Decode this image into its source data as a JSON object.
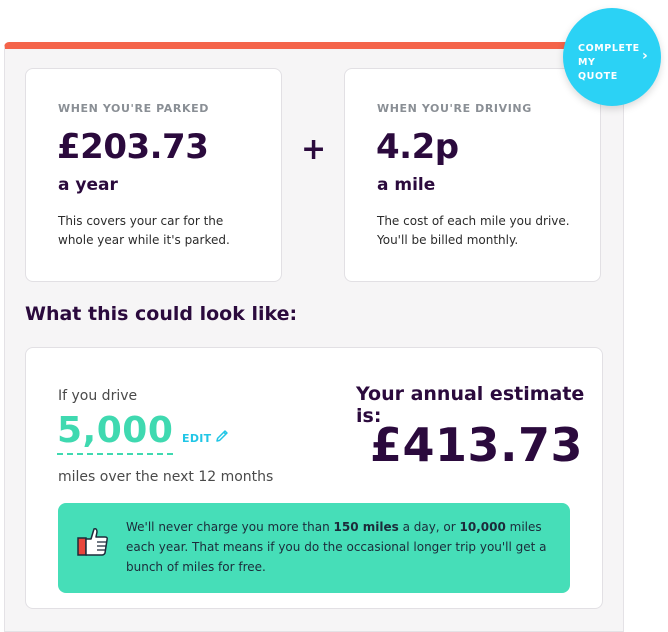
{
  "parked": {
    "eyebrow": "WHEN YOU'RE PARKED",
    "price": "£203.73",
    "period": "a year",
    "description": "This covers your car for the whole year while it's parked."
  },
  "plus_sign": "+",
  "driving": {
    "eyebrow": "WHEN YOU'RE DRIVING",
    "price": "4.2p",
    "period": "a mile",
    "description": "The cost of each mile you drive. You'll be billed monthly."
  },
  "section_title": "What this could look like:",
  "estimate": {
    "if_drive_label": "If you drive",
    "miles_value": "5,000",
    "edit_label": "EDIT",
    "miles_note": "miles over the next 12 months",
    "annual_label": "Your annual estimate is:",
    "annual_amount": "£413.73"
  },
  "banner": {
    "icon": "thumbs-up-icon",
    "text_part1": "We'll never charge you more than ",
    "bold1": "150 miles",
    "text_part2": " a day, or ",
    "bold2": "10,000",
    "text_part3": " miles each year. That means if you do the occasional longer trip you'll get a bunch of miles for free."
  },
  "cta": {
    "line1": "COMPLETE",
    "line2": "MY QUOTE",
    "chevron": "›"
  },
  "colors": {
    "accent_top": "#f4644a",
    "brand_purple": "#2b0a3d",
    "teal": "#3fd9b0",
    "banner_green": "#46deb8",
    "cta_blue": "#2bd2f5"
  }
}
